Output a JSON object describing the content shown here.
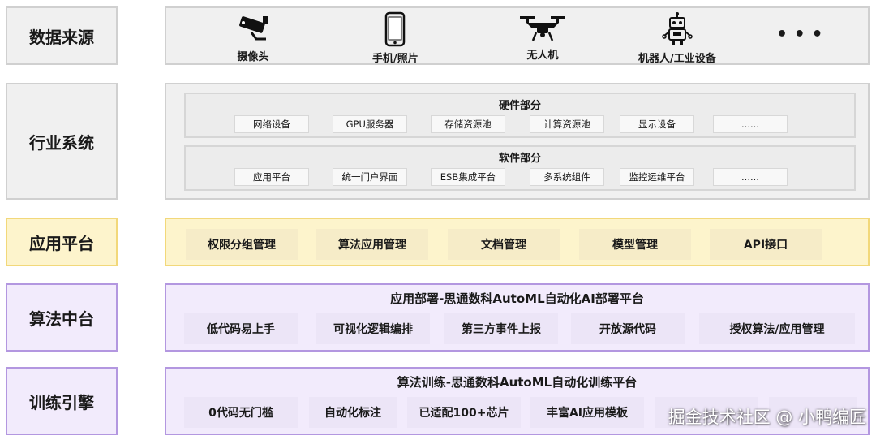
{
  "labels": {
    "data_source": "数据来源",
    "industry": "行业系统",
    "app_platform": "应用平台",
    "algo": "算法中台",
    "train": "训练引擎"
  },
  "sources": [
    "摄像头",
    "手机/照片",
    "无人机",
    "机器人/工业设备"
  ],
  "sources_more": "• • •",
  "hardware": {
    "title": "硬件部分",
    "items": [
      "网络设备",
      "GPU服务器",
      "存储资源池",
      "计算资源池",
      "显示设备",
      "......"
    ]
  },
  "software": {
    "title": "软件部分",
    "items": [
      "应用平台",
      "统一门户界面",
      "ESB集成平台",
      "多系统组件",
      "监控运维平台",
      "......"
    ]
  },
  "app_items": [
    "权限分组管理",
    "算法应用管理",
    "文档管理",
    "模型管理",
    "API接口"
  ],
  "algo_panel": {
    "title": "应用部署-思通数科AutoML自动化AI部署平台",
    "items": [
      "低代码易上手",
      "可视化逻辑编排",
      "第三方事件上报",
      "开放源代码",
      "授权算法/应用管理"
    ]
  },
  "train_panel": {
    "title": "算法训练-思通数科AutoML自动化训练平台",
    "items": [
      "0代码无门槛",
      "自动化标注",
      "已适配100+芯片",
      "丰富AI应用模板",
      "",
      ""
    ]
  },
  "watermark": "掘金技术社区 @ 小鸭编匠"
}
